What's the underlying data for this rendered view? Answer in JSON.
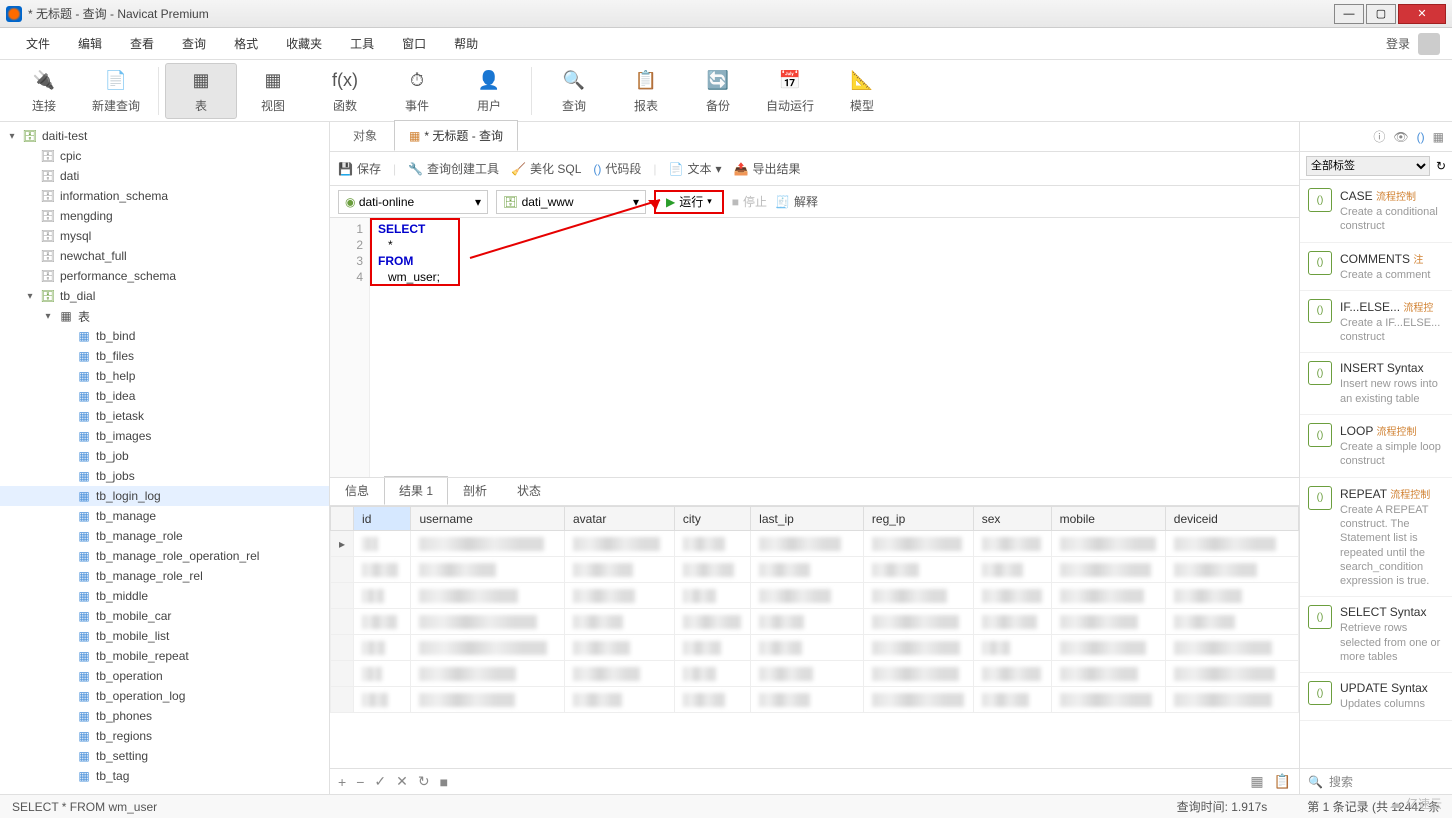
{
  "title": "* 无标题 - 查询 - Navicat Premium",
  "window_buttons": {
    "min": "—",
    "max": "▢",
    "close": "✕"
  },
  "menubar": [
    "文件",
    "编辑",
    "查看",
    "查询",
    "格式",
    "收藏夹",
    "工具",
    "窗口",
    "帮助"
  ],
  "menubar_login": "登录",
  "toolbar": [
    {
      "label": "连接",
      "icon": "🔌"
    },
    {
      "label": "新建查询",
      "icon": "📄"
    },
    {
      "label": "表",
      "icon": "▦",
      "active": true
    },
    {
      "label": "视图",
      "icon": "▦"
    },
    {
      "label": "函数",
      "icon": "f(x)"
    },
    {
      "label": "事件",
      "icon": "⏱"
    },
    {
      "label": "用户",
      "icon": "👤"
    },
    {
      "label": "查询",
      "icon": "🔍"
    },
    {
      "label": "报表",
      "icon": "📋"
    },
    {
      "label": "备份",
      "icon": "🔄"
    },
    {
      "label": "自动运行",
      "icon": "📅"
    },
    {
      "label": "模型",
      "icon": "📐"
    }
  ],
  "tree": [
    {
      "depth": 0,
      "icon": "db",
      "label": "daiti-test",
      "toggle": "▾"
    },
    {
      "depth": 1,
      "icon": "dbg",
      "label": "cpic"
    },
    {
      "depth": 1,
      "icon": "dbg",
      "label": "dati"
    },
    {
      "depth": 1,
      "icon": "dbg",
      "label": "information_schema"
    },
    {
      "depth": 1,
      "icon": "dbg",
      "label": "mengding"
    },
    {
      "depth": 1,
      "icon": "dbg",
      "label": "mysql"
    },
    {
      "depth": 1,
      "icon": "dbg",
      "label": "newchat_full"
    },
    {
      "depth": 1,
      "icon": "dbg",
      "label": "performance_schema"
    },
    {
      "depth": 1,
      "icon": "db",
      "label": "tb_dial",
      "toggle": "▾"
    },
    {
      "depth": 2,
      "icon": "folder",
      "label": "表",
      "toggle": "▾"
    },
    {
      "depth": 3,
      "icon": "tbl",
      "label": "tb_bind"
    },
    {
      "depth": 3,
      "icon": "tbl",
      "label": "tb_files"
    },
    {
      "depth": 3,
      "icon": "tbl",
      "label": "tb_help"
    },
    {
      "depth": 3,
      "icon": "tbl",
      "label": "tb_idea"
    },
    {
      "depth": 3,
      "icon": "tbl",
      "label": "tb_ietask"
    },
    {
      "depth": 3,
      "icon": "tbl",
      "label": "tb_images"
    },
    {
      "depth": 3,
      "icon": "tbl",
      "label": "tb_job"
    },
    {
      "depth": 3,
      "icon": "tbl",
      "label": "tb_jobs"
    },
    {
      "depth": 3,
      "icon": "tbl",
      "label": "tb_login_log",
      "selected": true
    },
    {
      "depth": 3,
      "icon": "tbl",
      "label": "tb_manage"
    },
    {
      "depth": 3,
      "icon": "tbl",
      "label": "tb_manage_role"
    },
    {
      "depth": 3,
      "icon": "tbl",
      "label": "tb_manage_role_operation_rel"
    },
    {
      "depth": 3,
      "icon": "tbl",
      "label": "tb_manage_role_rel"
    },
    {
      "depth": 3,
      "icon": "tbl",
      "label": "tb_middle"
    },
    {
      "depth": 3,
      "icon": "tbl",
      "label": "tb_mobile_car"
    },
    {
      "depth": 3,
      "icon": "tbl",
      "label": "tb_mobile_list"
    },
    {
      "depth": 3,
      "icon": "tbl",
      "label": "tb_mobile_repeat"
    },
    {
      "depth": 3,
      "icon": "tbl",
      "label": "tb_operation"
    },
    {
      "depth": 3,
      "icon": "tbl",
      "label": "tb_operation_log"
    },
    {
      "depth": 3,
      "icon": "tbl",
      "label": "tb_phones"
    },
    {
      "depth": 3,
      "icon": "tbl",
      "label": "tb_regions"
    },
    {
      "depth": 3,
      "icon": "tbl",
      "label": "tb_setting"
    },
    {
      "depth": 3,
      "icon": "tbl",
      "label": "tb_tag"
    }
  ],
  "tabs": {
    "objects": "对象",
    "query": "* 无标题 - 查询"
  },
  "querybar": {
    "save": "保存",
    "builder": "查询创建工具",
    "beautify": "美化 SQL",
    "snippet": "代码段",
    "text": "文本",
    "export": "导出结果"
  },
  "selectors": {
    "conn": "dati-online",
    "db": "dati_www"
  },
  "actions": {
    "run": "运行",
    "stop": "停止",
    "explain": "解释"
  },
  "sql": {
    "l1": "SELECT",
    "l2": "   *",
    "l3": "FROM",
    "l4": "   wm_user;"
  },
  "result_tabs": [
    "信息",
    "结果 1",
    "剖析",
    "状态"
  ],
  "columns": [
    "id",
    "username",
    "avatar",
    "city",
    "last_ip",
    "reg_ip",
    "sex",
    "mobile",
    "deviceid"
  ],
  "status": {
    "sql": "SELECT   * FROM  wm_user",
    "time": "查询时间: 1.917s",
    "records": "第 1 条记录 (共 12442 条"
  },
  "rp": {
    "filter": "全部标签",
    "search": "搜索",
    "snippets": [
      {
        "title": "CASE",
        "tag": "流程控制",
        "desc": "Create a conditional construct"
      },
      {
        "title": "COMMENTS",
        "tag": "注",
        "desc": "Create a comment"
      },
      {
        "title": "IF...ELSE...",
        "tag": "流程控",
        "desc": "Create a IF...ELSE... construct"
      },
      {
        "title": "INSERT Syntax",
        "tag": "",
        "desc": "Insert new rows into an existing table"
      },
      {
        "title": "LOOP",
        "tag": "流程控制",
        "desc": "Create a simple loop construct"
      },
      {
        "title": "REPEAT",
        "tag": "流程控制",
        "desc": "Create A REPEAT construct. The Statement list is repeated until the search_condition expression is true."
      },
      {
        "title": "SELECT Syntax",
        "tag": "",
        "desc": "Retrieve rows selected from one or more tables"
      },
      {
        "title": "UPDATE Syntax",
        "tag": "",
        "desc": "Updates columns"
      }
    ]
  },
  "watermark": "亿速云"
}
